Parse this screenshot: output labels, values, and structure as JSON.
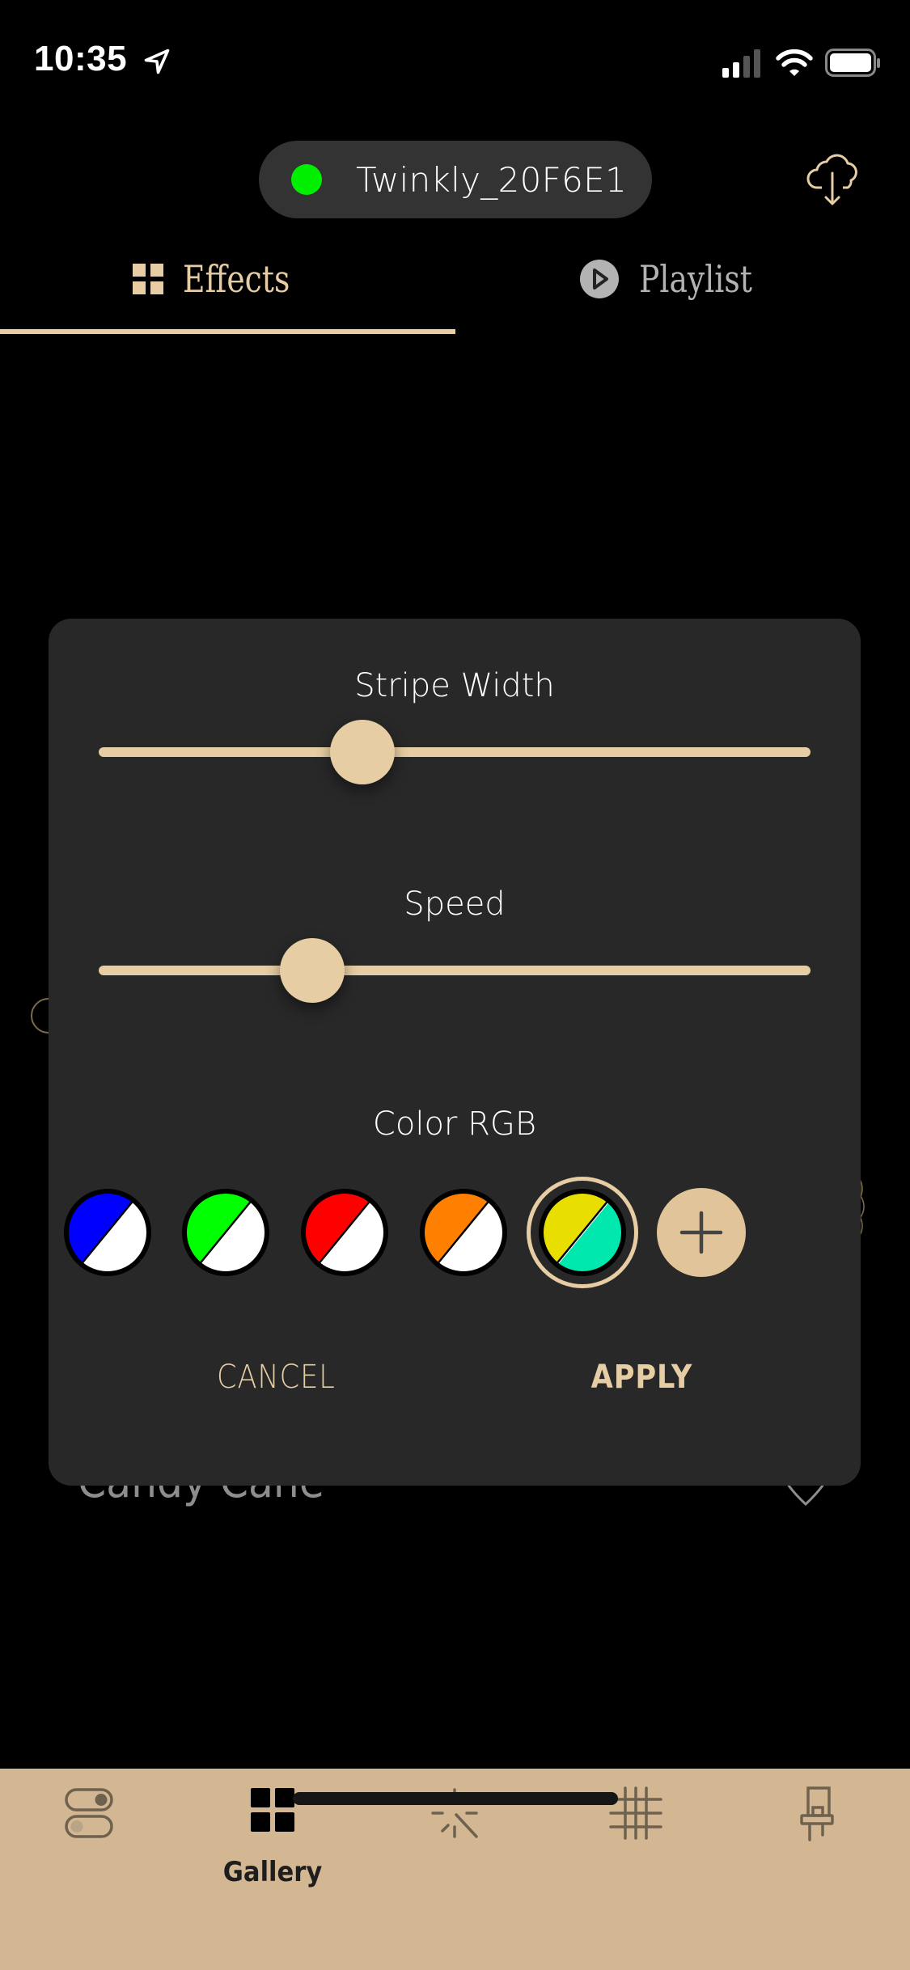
{
  "status_bar": {
    "time": "10:35",
    "icons": [
      "location-arrow-icon",
      "signal-icon",
      "wifi-icon",
      "battery-icon"
    ]
  },
  "header": {
    "device_name": "Twinkly_20F6E1",
    "device_status_color": "#00ee00",
    "cloud_icon": "cloud-download-icon"
  },
  "tabs": [
    {
      "label": "Effects",
      "icon": "grid-icon",
      "active": true
    },
    {
      "label": "Playlist",
      "icon": "play-circle-icon",
      "active": false
    }
  ],
  "background": {
    "effect_title": "Candy Cane",
    "favorite_icon": "heart-outline-icon"
  },
  "dialog": {
    "sliders": [
      {
        "label": "Stripe Width",
        "value": 0.37
      },
      {
        "label": "Speed",
        "value": 0.3
      }
    ],
    "color_section_label": "Color RGB",
    "swatches": [
      {
        "primary": "#0000ff",
        "secondary": "#ffffff",
        "selected": false
      },
      {
        "primary": "#00ff00",
        "secondary": "#ffffff",
        "selected": false
      },
      {
        "primary": "#ff0000",
        "secondary": "#ffffff",
        "selected": false
      },
      {
        "primary": "#ff8000",
        "secondary": "#ffffff",
        "selected": false
      },
      {
        "primary": "#e8de00",
        "secondary": "#00e8ae",
        "selected": true
      }
    ],
    "add_color_icon": "plus-icon",
    "cancel_label": "CANCEL",
    "apply_label": "APPLY"
  },
  "bottom_nav": {
    "items": [
      {
        "icon": "toggles-icon",
        "label": "",
        "active": false
      },
      {
        "icon": "gallery-grid-icon",
        "label": "Gallery",
        "active": true
      },
      {
        "icon": "sparkle-wand-icon",
        "label": "",
        "active": false
      },
      {
        "icon": "matrix-grid-icon",
        "label": "",
        "active": false
      },
      {
        "icon": "led-bulb-icon",
        "label": "",
        "active": false
      }
    ]
  },
  "colors": {
    "accent": "#e6cda3",
    "dialog_bg": "#282828",
    "nav_bg": "#d3b793"
  }
}
